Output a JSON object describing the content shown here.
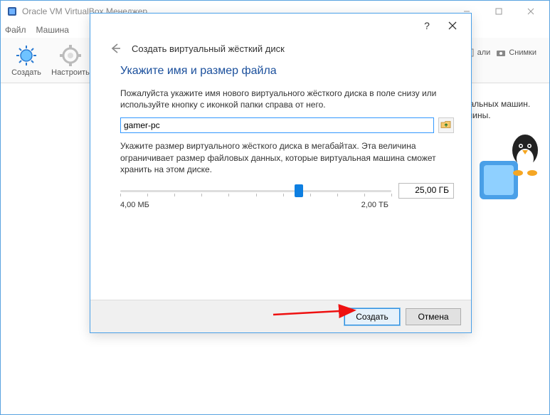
{
  "main": {
    "title": "Oracle VM VirtualBox Менеджер",
    "menu": {
      "file": "Файл",
      "machine": "Машина"
    },
    "toolbar": {
      "create": "Создать",
      "settings": "Настроить"
    },
    "tabs": {
      "details_partial": "али",
      "snapshots": "Снимки"
    },
    "welcome_partial_1": "туальных машин.",
    "welcome_partial_2": "ашины."
  },
  "dialog": {
    "header": "Создать виртуальный жёсткий диск",
    "section_title": "Укажите имя и размер файла",
    "para1": "Пожалуйста укажите имя нового виртуального жёсткого диска в поле снизу или используйте кнопку с иконкой папки справа от него.",
    "filename": "gamer-pc",
    "para2": "Укажите размер виртуального жёсткого диска в мегабайтах. Эта величина ограничивает размер файловых данных, которые виртуальная машина сможет хранить на этом диске.",
    "size_value": "25,00 ГБ",
    "slider_min": "4,00 МБ",
    "slider_max": "2,00 ТБ",
    "btn_create": "Создать",
    "btn_cancel": "Отмена"
  }
}
